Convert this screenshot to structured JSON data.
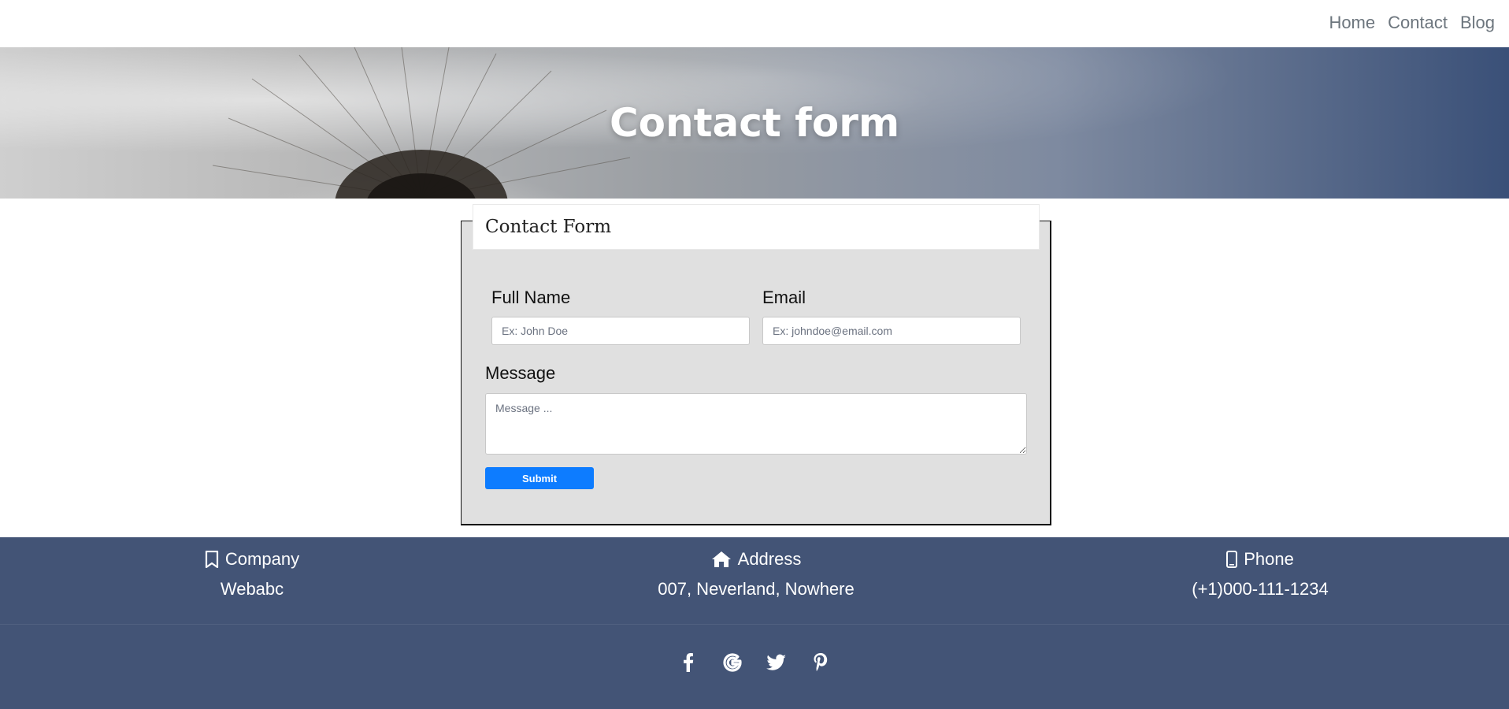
{
  "nav": {
    "items": [
      {
        "label": "Home"
      },
      {
        "label": "Contact"
      },
      {
        "label": "Blog"
      }
    ]
  },
  "hero": {
    "title": "Contact form"
  },
  "form": {
    "header": "Contact Form",
    "full_name_label": "Full Name",
    "full_name_placeholder": "Ex: John Doe",
    "email_label": "Email",
    "email_placeholder": "Ex: johndoe@email.com",
    "message_label": "Message",
    "message_placeholder": "Message ...",
    "submit_label": "Submit"
  },
  "footer": {
    "company": {
      "title": "Company",
      "value": "Webabc",
      "icon": "bookmark-icon"
    },
    "address": {
      "title": "Address",
      "value": "007, Neverland, Nowhere",
      "icon": "home-icon"
    },
    "phone": {
      "title": "Phone",
      "value": "(+1)000-111-1234",
      "icon": "phone-icon"
    },
    "socials": [
      {
        "name": "facebook-icon"
      },
      {
        "name": "google-icon"
      },
      {
        "name": "twitter-icon"
      },
      {
        "name": "pinterest-icon"
      }
    ]
  },
  "colors": {
    "accent": "#0d7cff",
    "footer_bg": "#435476",
    "form_bg": "#e0e0e0"
  }
}
